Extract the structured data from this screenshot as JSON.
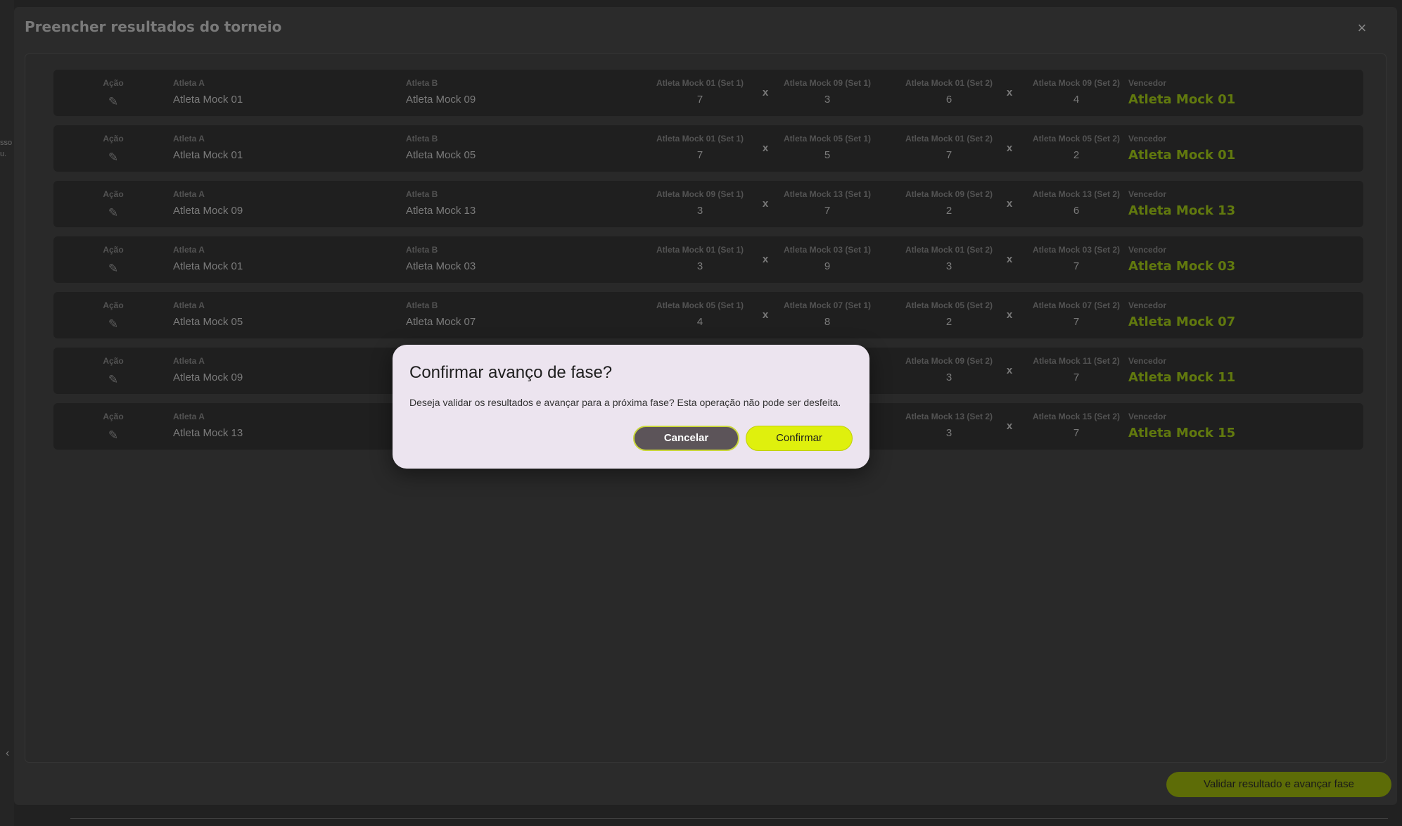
{
  "modal": {
    "title": "Preencher resultados do torneio",
    "close_icon": "×",
    "validate_label": "Validar resultado e avançar fase"
  },
  "labels": {
    "action": "Ação",
    "athlete_a": "Atleta A",
    "athlete_b": "Atleta B",
    "winner": "Vencedor",
    "x": "x"
  },
  "matches": [
    {
      "a": "Atleta Mock 01",
      "b": "Atleta Mock 09",
      "s1a_label": "Atleta Mock 01 (Set 1)",
      "s1a": "7",
      "s1b_label": "Atleta Mock 09 (Set 1)",
      "s1b": "3",
      "s2a_label": "Atleta Mock 01 (Set 2)",
      "s2a": "6",
      "s2b_label": "Atleta Mock 09 (Set 2)",
      "s2b": "4",
      "winner": "Atleta Mock 01"
    },
    {
      "a": "Atleta Mock 01",
      "b": "Atleta Mock 05",
      "s1a_label": "Atleta Mock 01 (Set 1)",
      "s1a": "7",
      "s1b_label": "Atleta Mock 05 (Set 1)",
      "s1b": "5",
      "s2a_label": "Atleta Mock 01 (Set 2)",
      "s2a": "7",
      "s2b_label": "Atleta Mock 05 (Set 2)",
      "s2b": "2",
      "winner": "Atleta Mock 01"
    },
    {
      "a": "Atleta Mock 09",
      "b": "Atleta Mock 13",
      "s1a_label": "Atleta Mock 09 (Set 1)",
      "s1a": "3",
      "s1b_label": "Atleta Mock 13 (Set 1)",
      "s1b": "7",
      "s2a_label": "Atleta Mock 09 (Set 2)",
      "s2a": "2",
      "s2b_label": "Atleta Mock 13 (Set 2)",
      "s2b": "6",
      "winner": "Atleta Mock 13"
    },
    {
      "a": "Atleta Mock 01",
      "b": "Atleta Mock 03",
      "s1a_label": "Atleta Mock 01 (Set 1)",
      "s1a": "3",
      "s1b_label": "Atleta Mock 03 (Set 1)",
      "s1b": "9",
      "s2a_label": "Atleta Mock 01 (Set 2)",
      "s2a": "3",
      "s2b_label": "Atleta Mock 03 (Set 2)",
      "s2b": "7",
      "winner": "Atleta Mock 03"
    },
    {
      "a": "Atleta Mock 05",
      "b": "Atleta Mock 07",
      "s1a_label": "Atleta Mock 05 (Set 1)",
      "s1a": "4",
      "s1b_label": "Atleta Mock 07 (Set 1)",
      "s1b": "8",
      "s2a_label": "Atleta Mock 05 (Set 2)",
      "s2a": "2",
      "s2b_label": "Atleta Mock 07 (Set 2)",
      "s2b": "7",
      "winner": "Atleta Mock 07"
    },
    {
      "a": "Atleta Mock 09",
      "b": "",
      "s1a_label": "",
      "s1a": "",
      "s1b_label": "",
      "s1b": "",
      "s2a_label": "Atleta Mock 09 (Set 2)",
      "s2a": "3",
      "s2b_label": "Atleta Mock 11 (Set 2)",
      "s2b": "7",
      "winner": "Atleta Mock 11"
    },
    {
      "a": "Atleta Mock 13",
      "b": "",
      "s1a_label": "",
      "s1a": "",
      "s1b_label": "",
      "s1b": "",
      "s2a_label": "Atleta Mock 13 (Set 2)",
      "s2a": "3",
      "s2b_label": "Atleta Mock 15 (Set 2)",
      "s2b": "7",
      "winner": "Atleta Mock 15"
    }
  ],
  "dialog": {
    "title": "Confirmar avanço de fase?",
    "message": "Deseja validar os resultados e avançar para a próxima fase? Esta operação não pode ser desfeita.",
    "cancel_label": "Cancelar",
    "confirm_label": "Confirmar"
  },
  "background": {
    "left_text_1": "sso",
    "left_text_2": "u.",
    "chevron": "‹"
  },
  "colors": {
    "accent": "#dff00d",
    "winner_dim": "#6f8a10",
    "dialog_bg": "#ece4ef"
  }
}
